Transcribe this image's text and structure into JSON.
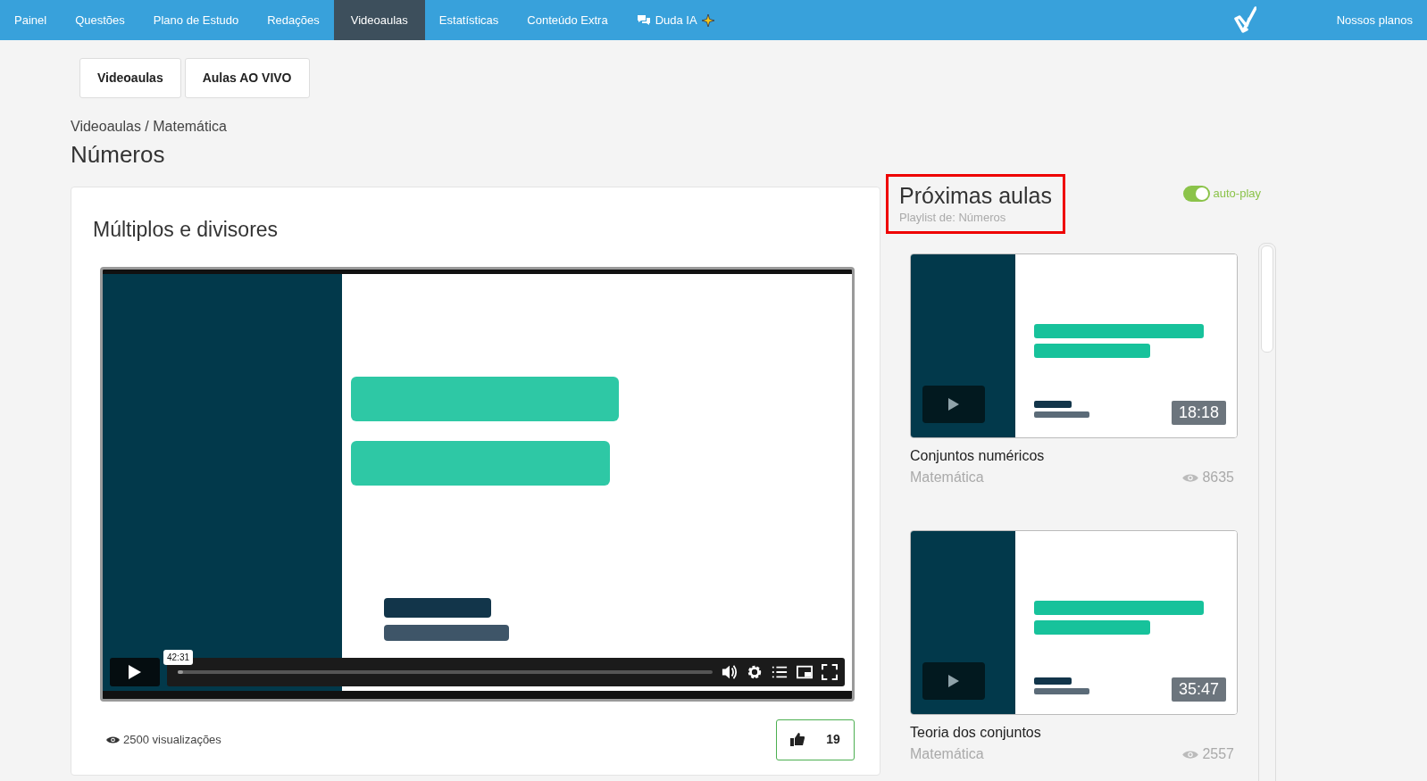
{
  "navbar": {
    "items": [
      {
        "label": "Painel",
        "selected": false,
        "kind": "link"
      },
      {
        "label": "Questões",
        "selected": false,
        "kind": "link"
      },
      {
        "label": "Plano de Estudo",
        "selected": false,
        "kind": "link"
      },
      {
        "label": "Redações",
        "selected": false,
        "kind": "link"
      },
      {
        "label": "Videoaulas",
        "selected": true,
        "kind": "link"
      },
      {
        "label": "Estatísticas",
        "selected": false,
        "kind": "link"
      },
      {
        "label": "Conteúdo Extra",
        "selected": false,
        "kind": "link"
      },
      {
        "label": "Duda IA",
        "selected": false,
        "kind": "ai"
      }
    ],
    "right_link": "Nossos planos"
  },
  "section_tabs": [
    {
      "label": "Videoaulas"
    },
    {
      "label": "Aulas AO VIVO"
    }
  ],
  "breadcrumb": "Videoaulas / Matemática",
  "title": "Números",
  "lesson": {
    "title": "Múltiplos e divisores",
    "player": {
      "tooltip": "42:31",
      "progress": {
        "level": 0.01
      }
    },
    "views": "2500 visualizações",
    "likes": "19"
  },
  "playlist": {
    "title": "Próximas aulas",
    "subtitle": "Playlist de: Números",
    "autoplay": {
      "label": "auto-play",
      "on": true
    },
    "items": [
      {
        "duration": "18:18",
        "title": "Conjuntos numéricos",
        "subject": "Matemática",
        "views": "8635"
      },
      {
        "duration": "35:47",
        "title": "Teoria dos conjuntos",
        "subject": "Matemática",
        "views": "2557"
      }
    ]
  }
}
